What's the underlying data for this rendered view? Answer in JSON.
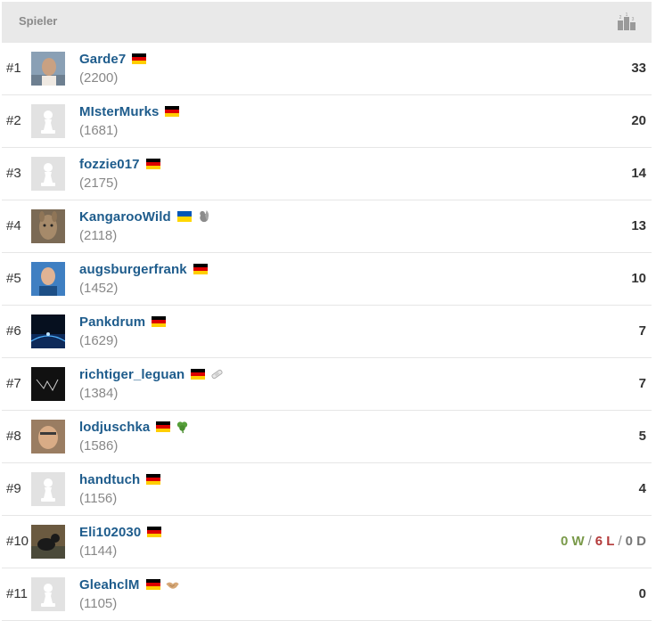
{
  "header": {
    "title": "Spieler",
    "icon": "podium-icon"
  },
  "players": [
    {
      "rank": "#1",
      "name": "Garde7",
      "rating": "(2200)",
      "flag": "de",
      "badge": null,
      "avatar": "photo-man",
      "score": "33"
    },
    {
      "rank": "#2",
      "name": "MIsterMurks",
      "rating": "(1681)",
      "flag": "de",
      "badge": null,
      "avatar": "pawn",
      "score": "20"
    },
    {
      "rank": "#3",
      "name": "fozzie017",
      "rating": "(2175)",
      "flag": "de",
      "badge": null,
      "avatar": "pawn",
      "score": "14"
    },
    {
      "rank": "#4",
      "name": "KangarooWild",
      "rating": "(2118)",
      "flag": "ua",
      "badge": "squirrel",
      "avatar": "photo-kangaroo",
      "score": "13"
    },
    {
      "rank": "#5",
      "name": "augsburgerfrank",
      "rating": "(1452)",
      "flag": "de",
      "badge": null,
      "avatar": "photo-blue",
      "score": "10"
    },
    {
      "rank": "#6",
      "name": "Pankdrum",
      "rating": "(1629)",
      "flag": "de",
      "badge": null,
      "avatar": "photo-night",
      "score": "7"
    },
    {
      "rank": "#7",
      "name": "richtiger_leguan",
      "rating": "(1384)",
      "flag": "de",
      "badge": "bandage",
      "avatar": "photo-dark",
      "score": "7"
    },
    {
      "rank": "#8",
      "name": "lodjuschka",
      "rating": "(1586)",
      "flag": "de",
      "badge": "clover",
      "avatar": "photo-face",
      "score": "5"
    },
    {
      "rank": "#9",
      "name": "handtuch",
      "rating": "(1156)",
      "flag": "de",
      "badge": null,
      "avatar": "pawn",
      "score": "4"
    },
    {
      "rank": "#10",
      "name": "Eli102030",
      "rating": "(1144)",
      "flag": "de",
      "badge": null,
      "avatar": "photo-dog",
      "score": null,
      "record": {
        "w": "0 W",
        "sep1": "/",
        "l": "6 L",
        "sep2": "/",
        "d": "0 D"
      }
    },
    {
      "rank": "#11",
      "name": "GleahclM",
      "rating": "(1105)",
      "flag": "de",
      "badge": "handshake",
      "avatar": "pawn",
      "score": "0"
    }
  ],
  "colors": {
    "link": "#1e5c8c",
    "win": "#7a9a4a",
    "loss": "#b33a3a",
    "header_bg": "#e9e9e9"
  }
}
